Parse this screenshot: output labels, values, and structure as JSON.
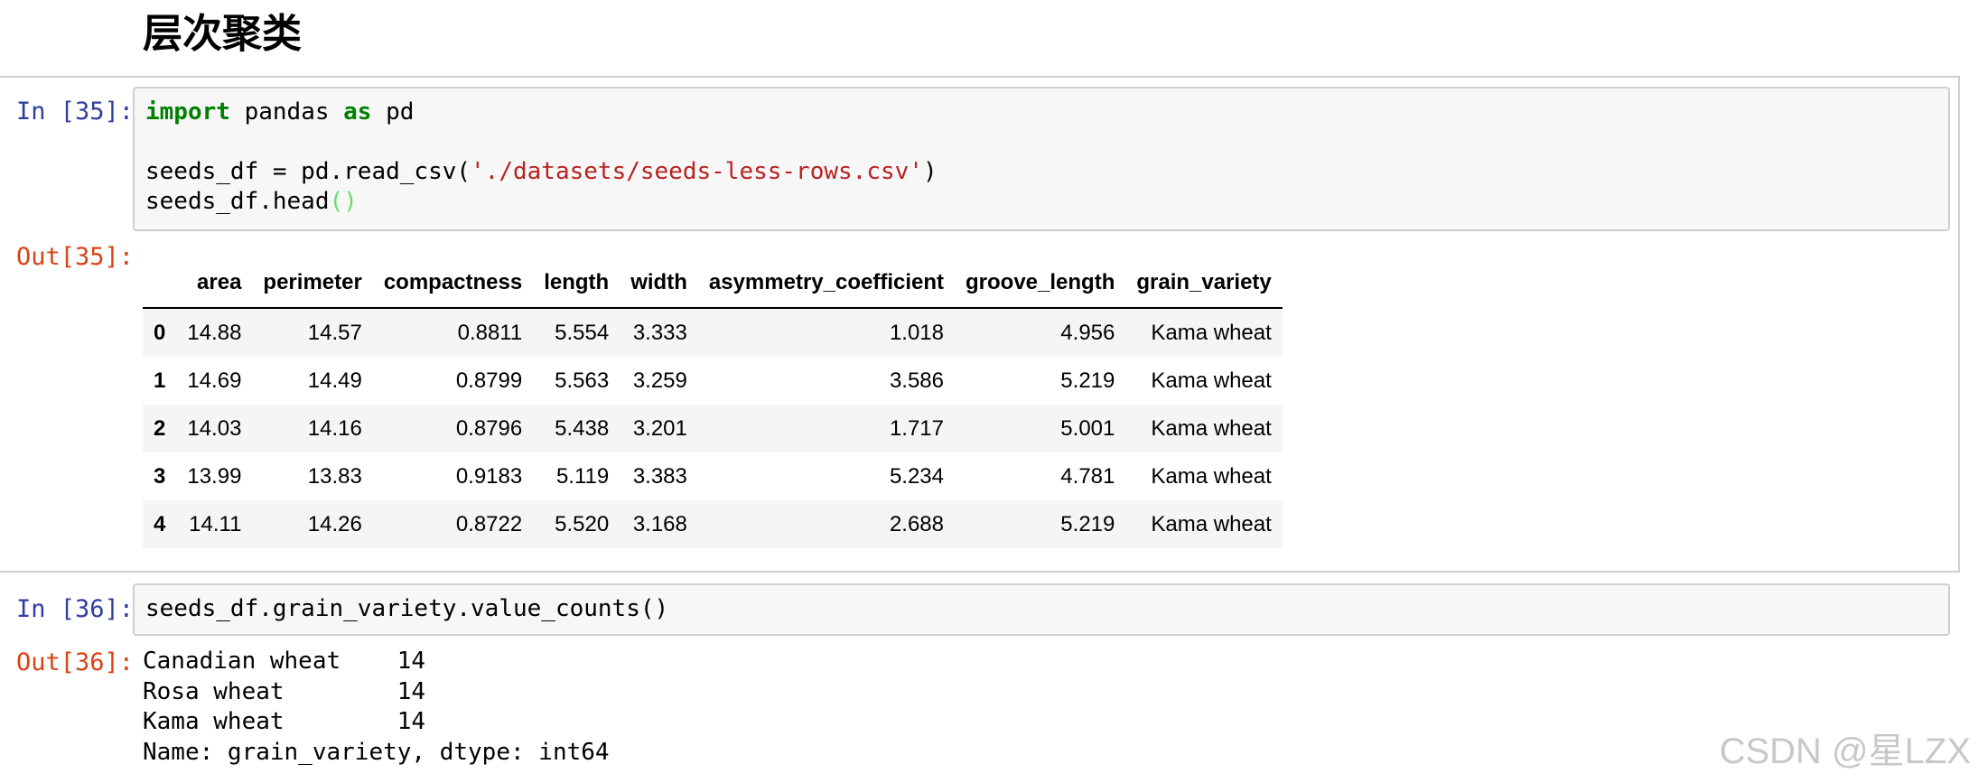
{
  "heading": "层次聚类",
  "cell35": {
    "in_prompt": "In [35]:",
    "out_prompt": "Out[35]:",
    "code": {
      "kw_import": "import",
      "mod": " pandas ",
      "kw_as": "as",
      "alias": " pd",
      "line2_pre": "seeds_df = pd.read_csv(",
      "line2_str": "'./datasets/seeds-less-rows.csv'",
      "line2_post": ")",
      "line3_pre": "seeds_df.head",
      "line3_paren": "()"
    },
    "table": {
      "columns": [
        "",
        "area",
        "perimeter",
        "compactness",
        "length",
        "width",
        "asymmetry_coefficient",
        "groove_length",
        "grain_variety"
      ],
      "rows": [
        [
          "0",
          "14.88",
          "14.57",
          "0.8811",
          "5.554",
          "3.333",
          "1.018",
          "4.956",
          "Kama wheat"
        ],
        [
          "1",
          "14.69",
          "14.49",
          "0.8799",
          "5.563",
          "3.259",
          "3.586",
          "5.219",
          "Kama wheat"
        ],
        [
          "2",
          "14.03",
          "14.16",
          "0.8796",
          "5.438",
          "3.201",
          "1.717",
          "5.001",
          "Kama wheat"
        ],
        [
          "3",
          "13.99",
          "13.83",
          "0.9183",
          "5.119",
          "3.383",
          "5.234",
          "4.781",
          "Kama wheat"
        ],
        [
          "4",
          "14.11",
          "14.26",
          "0.8722",
          "5.520",
          "3.168",
          "2.688",
          "5.219",
          "Kama wheat"
        ]
      ]
    }
  },
  "cell36": {
    "in_prompt": "In [36]:",
    "out_prompt": "Out[36]:",
    "code": "seeds_df.grain_variety.value_counts()",
    "output": [
      "Canadian wheat    14",
      "Rosa wheat        14",
      "Kama wheat        14",
      "Name: grain_variety, dtype: int64"
    ]
  },
  "watermark": "CSDN @星LZX"
}
